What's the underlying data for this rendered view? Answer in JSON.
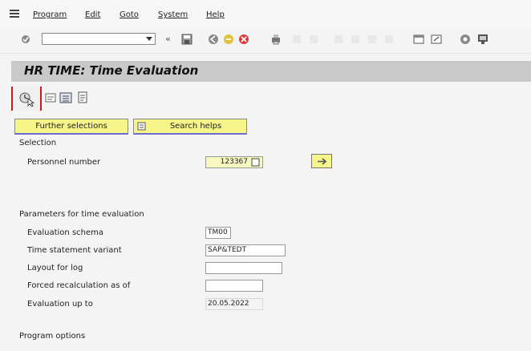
{
  "menu": {
    "items": [
      "Program",
      "Edit",
      "Goto",
      "System",
      "Help"
    ]
  },
  "toolbar": {
    "command_value": ""
  },
  "title": "HR TIME: Time Evaluation",
  "buttons": {
    "further_selections": "Further selections",
    "search_helps": "Search helps"
  },
  "selection": {
    "heading": "Selection",
    "personnel_number_label": "Personnel number",
    "personnel_number_value": "123367"
  },
  "parameters": {
    "heading": "Parameters for time evaluation",
    "rows": [
      {
        "label": "Evaluation schema",
        "value": "TM00"
      },
      {
        "label": "Time statement variant",
        "value": "SAP&TEDT"
      },
      {
        "label": "Layout for log",
        "value": ""
      },
      {
        "label": "Forced recalculation as of",
        "value": ""
      },
      {
        "label": "Evaluation up to",
        "value": "20.05.2022"
      }
    ]
  },
  "program_options": {
    "heading": "Program options"
  },
  "colors": {
    "button_yellow": "#f5f58a",
    "title_gray": "#c9c9c9",
    "highlight_red": "#d01818"
  }
}
